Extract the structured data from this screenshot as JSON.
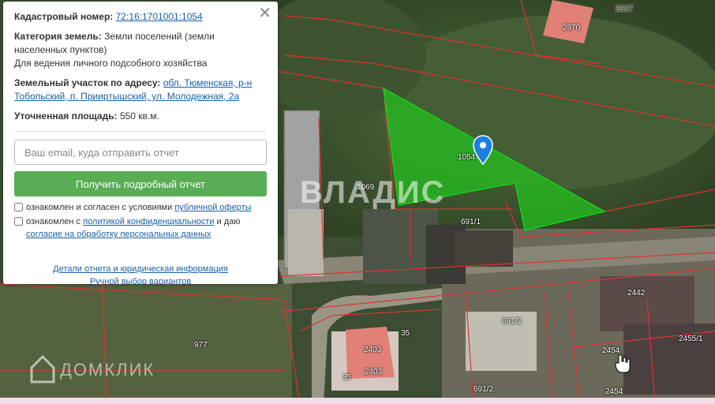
{
  "panel": {
    "cadastral_label": "Кадастровый номер:",
    "cadastral_value": "72:16:1701001:1054",
    "category_label": "Категория земель:",
    "category_value": "Земли поселений (земли населенных пунктов)",
    "usage": "Для ведения личного подсобного хозяйства",
    "address_label": "Земельный участок по адресу:",
    "address_value": "обл. Тюменская, р-н Тобольский, п. Прииртышский, ул. Молодежная, 2а",
    "area_label": "Уточненная площадь:",
    "area_value": "550 кв.м.",
    "email_placeholder": "Ваш email, куда отправить отчет",
    "cta_label": "Получить подробный отчет",
    "consent1_text": "ознакомлен и согласен с условиями",
    "consent1_link": "публичной оферты",
    "consent2_text1": "ознакомлен с",
    "consent2_link1": "политикой конфиденциальности",
    "consent2_text2": "и даю",
    "consent2_link2": "согласие на обработку персональных данных",
    "details_link": "Детали отчета и юридическая информация",
    "manual_link": "Ручной выбор вариантов",
    "close_glyph": "✕"
  },
  "map": {
    "selected_plot": "1054",
    "plot_labels": [
      "2870",
      "2627",
      "1069",
      "691/1",
      "2442",
      "691/2",
      "2455/1",
      "2454",
      "2403",
      "2403",
      "35",
      "35",
      "977",
      "691/2",
      "2454"
    ],
    "watermark_vladis": "ВЛАДИС",
    "watermark_domklik": "ДОМКЛИК",
    "highlight_color": "#21c41f",
    "boundary_color": "#e03232"
  }
}
